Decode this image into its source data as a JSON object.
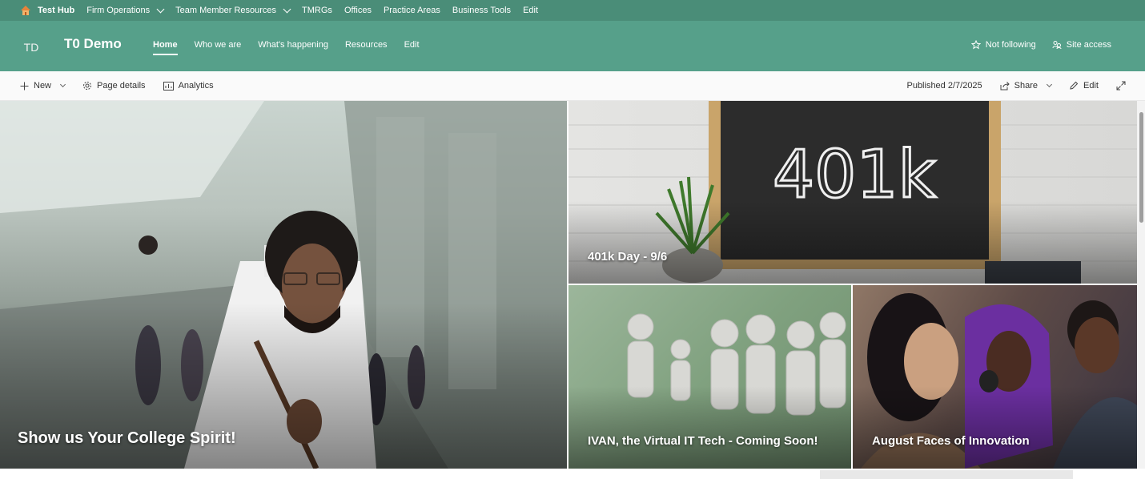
{
  "hub": {
    "title": "Test Hub",
    "items": [
      {
        "label": "Firm Operations",
        "dropdown": true
      },
      {
        "label": "Team Member Resources",
        "dropdown": true
      },
      {
        "label": "TMRGs",
        "dropdown": false
      },
      {
        "label": "Offices",
        "dropdown": false
      },
      {
        "label": "Practice Areas",
        "dropdown": false
      },
      {
        "label": "Business Tools",
        "dropdown": false
      },
      {
        "label": "Edit",
        "dropdown": false
      }
    ]
  },
  "site": {
    "logo_initials": "TD",
    "title": "T0 Demo",
    "nav": [
      "Home",
      "Who we are",
      "What's happening",
      "Resources",
      "Edit"
    ],
    "follow_label": "Not following",
    "access_label": "Site access"
  },
  "command": {
    "new_label": "New",
    "page_details_label": "Page details",
    "analytics_label": "Analytics",
    "published_label": "Published 2/7/2025",
    "share_label": "Share",
    "edit_label": "Edit"
  },
  "hero": {
    "tiles": [
      {
        "title": "Show us Your College Spirit!"
      },
      {
        "title": "401k Day - 9/6",
        "chalk_text": "401k"
      },
      {
        "title": "IVAN, the Virtual IT Tech - Coming Soon!"
      },
      {
        "title": "August Faces of Innovation"
      }
    ]
  },
  "colors": {
    "hub_bg": "#4a8d78",
    "site_bg": "#56a08a"
  }
}
